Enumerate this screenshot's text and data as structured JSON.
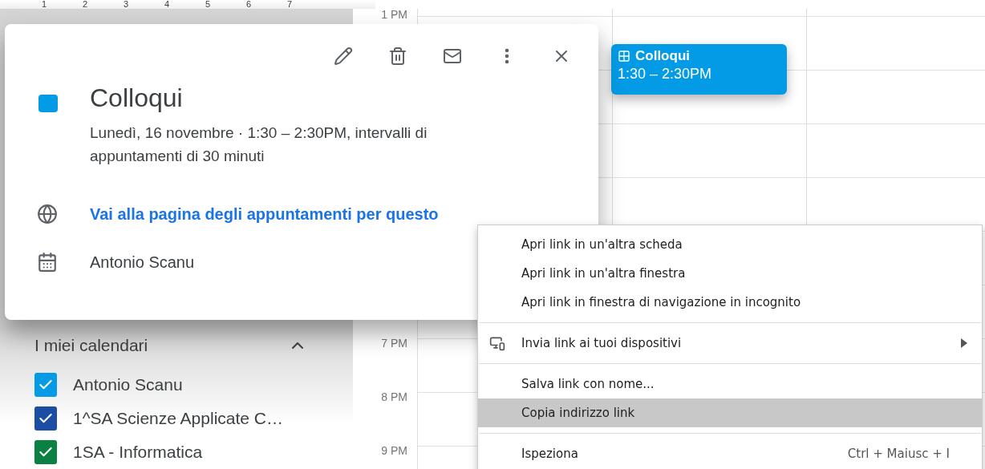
{
  "mini_calendar": {
    "days": [
      "1",
      "2",
      "3",
      "4",
      "5",
      "6",
      "7"
    ]
  },
  "time_column": {
    "above_popup": [
      "1 PM"
    ],
    "below_popup": [
      "7 PM",
      "8 PM",
      "9 PM"
    ]
  },
  "event_chip": {
    "title": "Colloqui",
    "time": "1:30 – 2:30PM"
  },
  "event_popup": {
    "title": "Colloqui",
    "when": "Lunedì, 16 novembre  ·  1:30 – 2:30PM, intervalli di appuntamenti di 30 minuti",
    "link": "Vai alla pagina degli appuntamenti per questo",
    "calendar": "Antonio Scanu"
  },
  "sidebar": {
    "heading": "I miei calendari",
    "expanded": true,
    "calendars": [
      {
        "name": "Antonio Scanu",
        "checked": true,
        "color": "#039be5"
      },
      {
        "name": "1^SA Scienze Applicate C…",
        "checked": true,
        "color": "#1b4ea3"
      },
      {
        "name": "1SA - Informatica",
        "checked": true,
        "color": "#0b8043"
      }
    ]
  },
  "context_menu": {
    "groups": [
      {
        "items": [
          {
            "label": "Apri link in un'altra scheda",
            "kind": "plain",
            "highlighted": false
          },
          {
            "label": "Apri link in un'altra finestra",
            "kind": "plain",
            "highlighted": false
          },
          {
            "label": "Apri link in finestra di navigazione in incognito",
            "kind": "plain",
            "highlighted": false
          }
        ]
      },
      {
        "items": [
          {
            "label": "Invia link ai tuoi dispositivi",
            "kind": "with-icon",
            "submenu": true,
            "highlighted": false
          }
        ]
      },
      {
        "items": [
          {
            "label": "Salva link con nome...",
            "kind": "plain",
            "highlighted": false
          },
          {
            "label": "Copia indirizzo link",
            "kind": "plain",
            "highlighted": true
          }
        ]
      },
      {
        "items": [
          {
            "label": "Ispeziona",
            "kind": "plain",
            "shortcut": "Ctrl + Maiusc + I",
            "highlighted": false
          }
        ]
      }
    ]
  }
}
